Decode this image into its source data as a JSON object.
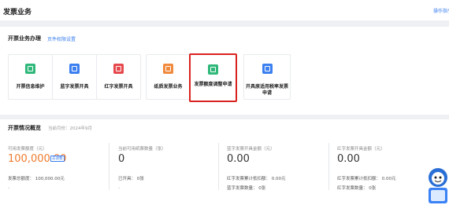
{
  "header": {
    "title": "发票业务",
    "help_link": "操作指引"
  },
  "invoice_ops": {
    "title": "开票业务办理",
    "settings_link": "页件权限设置",
    "cards": [
      {
        "label": "开票信息维护",
        "icon": "edit-doc-icon",
        "color": "#2fb87a"
      },
      {
        "label": "蓝字发票开具",
        "icon": "blue-invoice-icon",
        "color": "#3b7ff0"
      },
      {
        "label": "红字发票开具",
        "icon": "red-invoice-icon",
        "color": "#e5484d"
      },
      {
        "label": "纸质发票业务",
        "icon": "paper-invoice-icon",
        "color": "#f08a3c"
      },
      {
        "label": "发票额度调整申请",
        "icon": "quota-adjust-icon",
        "color": "#2fb87a"
      },
      {
        "label": "开具原适用税率发票申请",
        "icon": "tax-rate-doc-icon",
        "color": "#3b7ff0"
      }
    ]
  },
  "overview": {
    "title": "开票情况概览",
    "period": "当前月份：2024年9月",
    "col1": {
      "label": "可用发票额度（元）",
      "value": "100,000.00",
      "badge": "去调整",
      "sub": "发票总额度：  100,000.00元",
      "dash": "-"
    },
    "col2": {
      "label": "当前可用纸票数量（张）",
      "value": "0",
      "sub": "已开具：      0张",
      "dash": "-"
    },
    "col3": {
      "label": "蓝字发票开具金额（元）",
      "value": "0.00",
      "sub1": "红字发票累计抵扣额：  0.00元",
      "sub2": "蓝字发票数量：      0张"
    },
    "col4": {
      "label": "红字发票开具金额（元）",
      "value": "0.00",
      "sub1": "红字发票累计抵扣额：  0.00元",
      "sub2": "红字发票数量：      0张"
    }
  },
  "colors": {
    "accent": "#3b7ff0",
    "highlight": "#d9221f",
    "amount": "#f07a2c"
  }
}
